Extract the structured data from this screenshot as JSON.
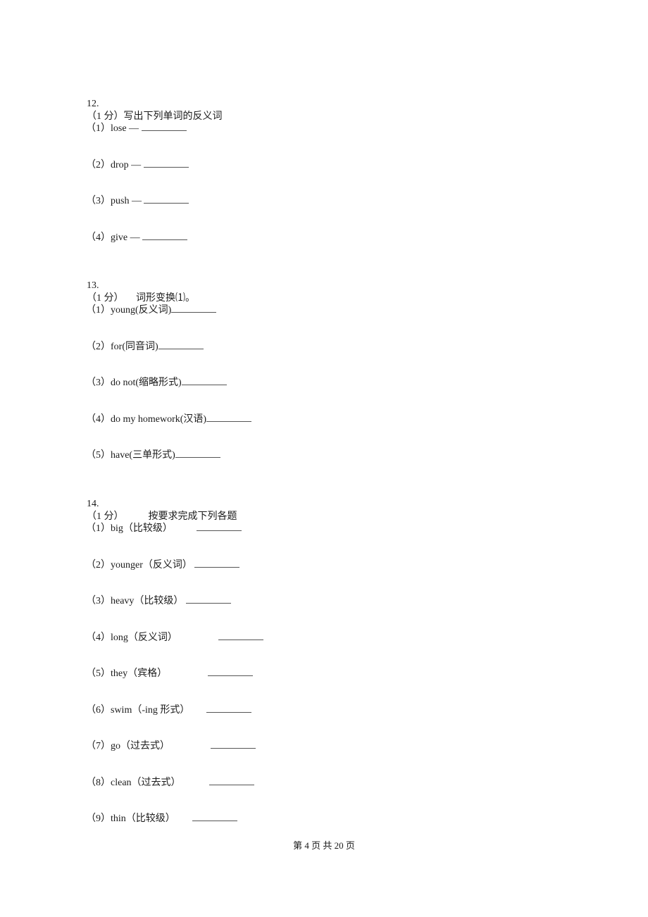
{
  "questions": [
    {
      "number": "12.",
      "score": "（1 分）",
      "title": "写出下列单词的反义词",
      "items": [
        {
          "label": "（1）",
          "text": "lose —",
          "blank": ""
        },
        {
          "label": "（2）",
          "text": "drop —",
          "blank": ""
        },
        {
          "label": "（3）",
          "text": "push —",
          "blank": ""
        },
        {
          "label": "（4）",
          "text": "give —",
          "blank": ""
        }
      ]
    },
    {
      "number": "13.",
      "score": "（1 分）",
      "title": "词形变换⑴。",
      "items": [
        {
          "label": "（1）",
          "text": "young(反义词)",
          "blank": ""
        },
        {
          "label": "（2）",
          "text": "for(同音词)",
          "blank": ""
        },
        {
          "label": "（3）",
          "text": "do not(缩略形式)",
          "blank": ""
        },
        {
          "label": "（4）",
          "text": "do my homework(汉语)",
          "blank": ""
        },
        {
          "label": "（5）",
          "text": "have(三单形式)",
          "blank": ""
        }
      ]
    },
    {
      "number": "14.",
      "score": "（1 分）",
      "title": "按要求完成下列各题",
      "items": [
        {
          "label": "（1）",
          "text": "big（比较级）",
          "blank": ""
        },
        {
          "label": "（2）",
          "text": "younger（反义词）",
          "blank": ""
        },
        {
          "label": "（3）",
          "text": "heavy（比较级）",
          "blank": ""
        },
        {
          "label": "（4）",
          "text": "long（反义词）",
          "blank": ""
        },
        {
          "label": "（5）",
          "text": "they（宾格）",
          "blank": ""
        },
        {
          "label": "（6）",
          "text": "swim（-ing 形式）",
          "blank": ""
        },
        {
          "label": "（7）",
          "text": "go（过去式）",
          "blank": ""
        },
        {
          "label": "（8）",
          "text": "clean（过去式）",
          "blank": ""
        },
        {
          "label": "（9）",
          "text": "thin（比较级）",
          "blank": ""
        }
      ]
    }
  ],
  "footer": {
    "text": "第 4 页 共 20 页"
  }
}
